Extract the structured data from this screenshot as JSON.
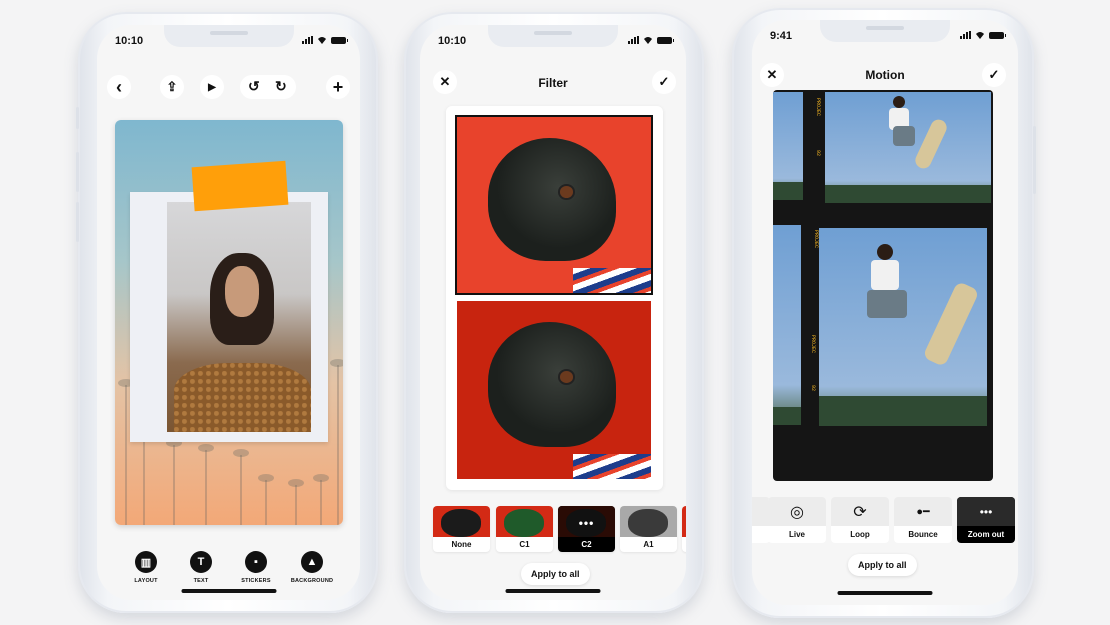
{
  "phones": [
    {
      "id": "story-editor",
      "status_time": "10:10",
      "toolbar": {
        "back_icon": "chevron-left-icon",
        "share_icon": "share-upload-icon",
        "play_icon": "play-icon",
        "undo_icon": "undo-icon",
        "redo_icon": "redo-icon",
        "add_icon": "plus-icon"
      },
      "canvas": {
        "background": "sunset palm trees gradient",
        "photo": "smiling woman in polaroid frame",
        "tape_color": "#ff9f0a"
      },
      "tools": [
        {
          "label": "LAYOUT",
          "icon": "layout-book-icon"
        },
        {
          "label": "TEXT",
          "icon": "text-t-icon"
        },
        {
          "label": "STICKERS",
          "icon": "sticker-icon"
        },
        {
          "label": "BACKGROUND",
          "icon": "mountain-image-icon"
        }
      ]
    },
    {
      "id": "filter",
      "status_time": "10:10",
      "title": "Filter",
      "close_icon": "close-x-icon",
      "confirm_icon": "checkmark-icon",
      "photos": [
        "pug on red (selected)",
        "pug on red"
      ],
      "filters": [
        {
          "label": "None",
          "active": false
        },
        {
          "label": "C1",
          "active": false
        },
        {
          "label": "C2",
          "active": true,
          "overlay": "•••"
        },
        {
          "label": "A1",
          "active": false
        }
      ],
      "apply_label": "Apply to all"
    },
    {
      "id": "motion",
      "status_time": "9:41",
      "title": "Motion",
      "close_icon": "close-x-icon",
      "confirm_icon": "checkmark-icon",
      "preview": "film strip of skateboarder jumping",
      "film_text": [
        "PROJEC",
        "92",
        "PROJEC",
        "PROJEC",
        "92"
      ],
      "effects": [
        {
          "label": "",
          "icon": "",
          "active": false
        },
        {
          "label": "Live",
          "icon": "◎",
          "active": false
        },
        {
          "label": "Loop",
          "icon": "⟳",
          "active": false
        },
        {
          "label": "Bounce",
          "icon": "●━",
          "active": false
        },
        {
          "label": "Zoom out",
          "icon": "•••",
          "active": true
        }
      ],
      "apply_label": "Apply to all"
    }
  ],
  "icons": {
    "back": "‹",
    "share": "⇪",
    "play": "▶",
    "undo": "↺",
    "redo": "↻",
    "add": "+",
    "close": "✕",
    "check": "✓",
    "text": "T"
  }
}
